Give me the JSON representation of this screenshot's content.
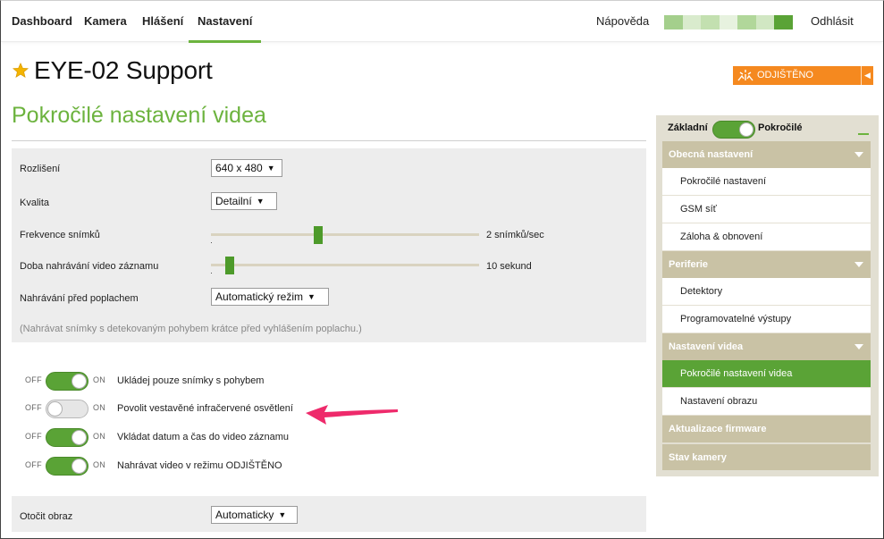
{
  "nav": {
    "items": [
      {
        "label": "Dashboard"
      },
      {
        "label": "Kamera"
      },
      {
        "label": "Hlášení"
      },
      {
        "label": "Nastavení"
      }
    ],
    "active_index": 3,
    "help": "Nápověda",
    "logout": "Odhlásit",
    "signal_colors": [
      "#a4cf8c",
      "#d9ebcd",
      "#c3e0b0",
      "#e7f2df",
      "#b1d79a",
      "#d1e7c3",
      "#5aa336"
    ]
  },
  "header": {
    "device_name": "EYE-02 Support",
    "favorite_icon": "star-icon",
    "armed_button": "ODJIŠTĚNO",
    "armed_icon": "armed-status-icon",
    "accent_color": "#f5891f"
  },
  "page": {
    "title": "Pokročilé nastavení videa",
    "accent_color": "#6cb33e"
  },
  "settings": {
    "resolution": {
      "label": "Rozlišení",
      "value": "640 x 480"
    },
    "quality": {
      "label": "Kvalita",
      "value": "Detailní"
    },
    "frame_rate": {
      "label": "Frekvence snímků",
      "value_text": "2 snímků/sec",
      "level": 0.4
    },
    "record_duration": {
      "label": "Doba nahrávání video záznamu",
      "value_text": "10 sekund",
      "level": 0.07
    },
    "pre_alarm": {
      "label": "Nahrávání před poplachem",
      "value": "Automatický režim"
    },
    "hint": "(Nahrávat snímky s detekovaným pohybem krátce před vyhlášením poplachu.)"
  },
  "toggles": {
    "off_label": "OFF",
    "on_label": "ON",
    "items": [
      {
        "label": "Ukládej pouze snímky s pohybem",
        "on": true
      },
      {
        "label": "Povolit vestavěné infračervené osvětlení",
        "on": false
      },
      {
        "label": "Vkládat datum a čas do video záznamu",
        "on": true
      },
      {
        "label": "Nahrávat video v režimu ODJIŠTĚNO",
        "on": true
      }
    ]
  },
  "rotate": {
    "label": "Otočit obraz",
    "value": "Automaticky"
  },
  "sidebar": {
    "mode_basic": "Základní",
    "mode_advanced": "Pokročilé",
    "sections": [
      {
        "label": "Obecná nastavení",
        "items": [
          "Pokročilé nastavení",
          "GSM síť",
          "Záloha & obnovení"
        ]
      },
      {
        "label": "Periferie",
        "items": [
          "Detektory",
          "Programovatelné výstupy"
        ]
      },
      {
        "label": "Nastavení videa",
        "items": [
          "Pokročilé nastavení videa",
          "Nastavení obrazu"
        ]
      },
      {
        "label": "Aktualizace firmware",
        "items": []
      },
      {
        "label": "Stav kamery",
        "items": []
      }
    ],
    "active_item": "Pokročilé nastavení videa"
  },
  "annotation": {
    "arrow_color": "#ee2a6b"
  }
}
